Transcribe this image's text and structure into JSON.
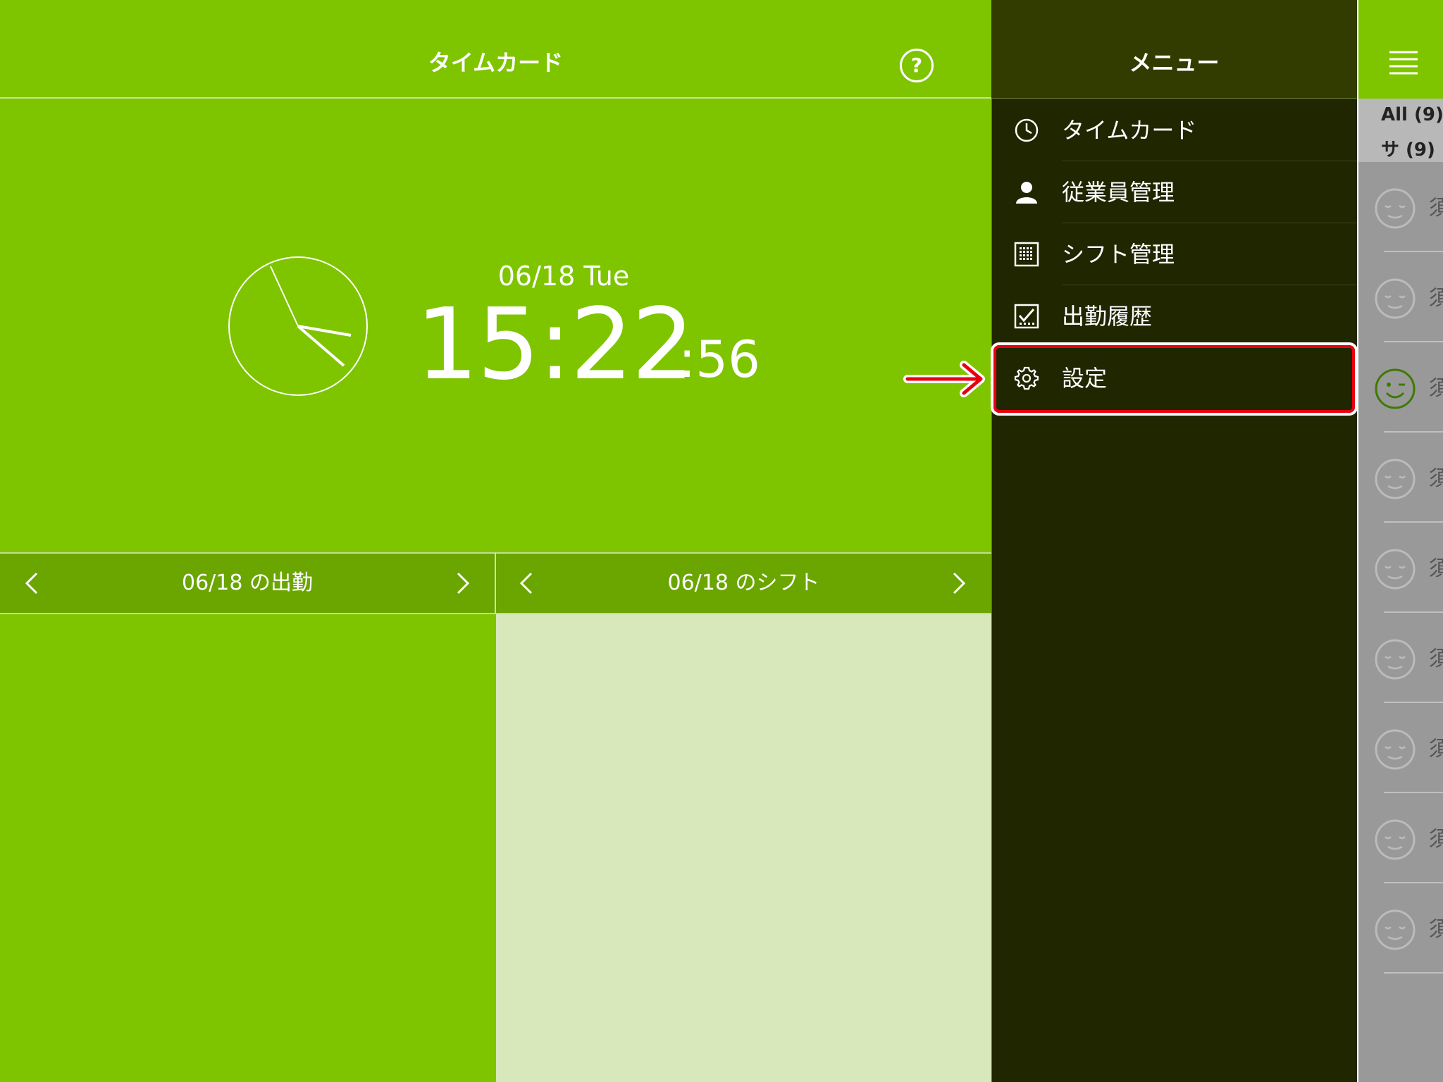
{
  "timecard": {
    "title": "タイムカード",
    "help_label": "?",
    "date": "06/18 Tue",
    "time": "15:22",
    "seconds": ":56",
    "attendance": {
      "title": "06/18 の出勤"
    },
    "shift": {
      "title": "06/18 のシフト"
    }
  },
  "menu": {
    "title": "メニュー",
    "items": [
      {
        "label": "タイムカード",
        "icon": "clock-icon"
      },
      {
        "label": "従業員管理",
        "icon": "person-icon"
      },
      {
        "label": "シフト管理",
        "icon": "calendar-grid-icon"
      },
      {
        "label": "出勤履歴",
        "icon": "history-check-icon"
      },
      {
        "label": "設定",
        "icon": "gear-icon",
        "highlighted": true
      }
    ]
  },
  "employees": {
    "filters": [
      {
        "label": "All (9)"
      },
      {
        "label": "サ (9)"
      }
    ],
    "rows": [
      {
        "name": "須",
        "active": false
      },
      {
        "name": "須",
        "active": false
      },
      {
        "name": "須",
        "active": true
      },
      {
        "name": "須",
        "active": false
      },
      {
        "name": "須",
        "active": false
      },
      {
        "name": "須",
        "active": false
      },
      {
        "name": "須",
        "active": false
      },
      {
        "name": "須",
        "active": false
      },
      {
        "name": "須",
        "active": false
      }
    ]
  },
  "colors": {
    "accent_green": "#7ec500",
    "menu_bg": "#202600",
    "highlight_red": "#e8000f"
  }
}
